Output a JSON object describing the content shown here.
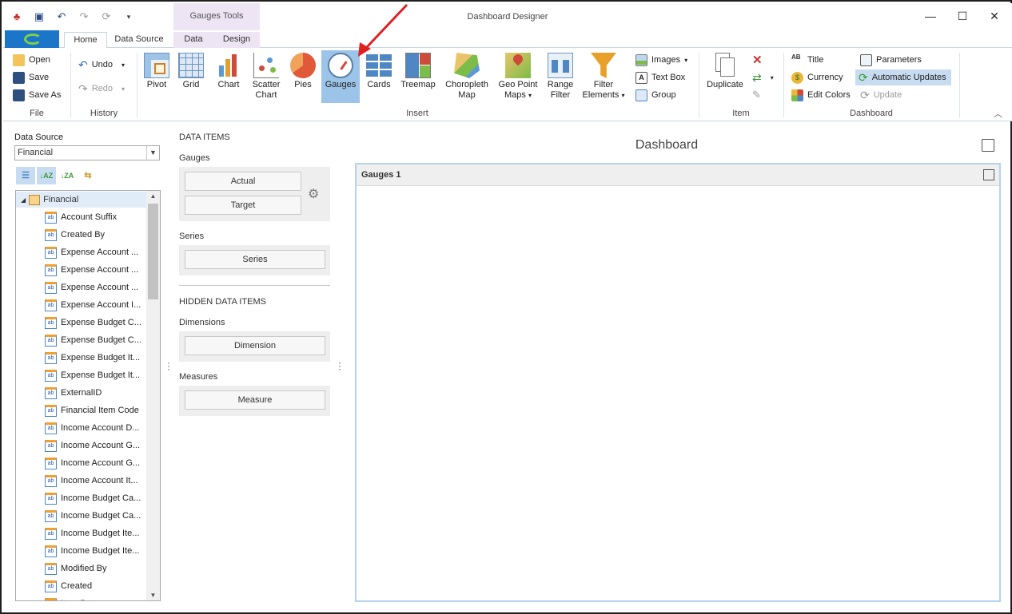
{
  "app_title": "Dashboard Designer",
  "context_tab_group": "Gauges Tools",
  "tabs": [
    "Home",
    "Data Source",
    "Data",
    "Design"
  ],
  "ribbon": {
    "file": {
      "label": "File",
      "open": "Open",
      "save": "Save",
      "save_as": "Save As"
    },
    "history": {
      "label": "History",
      "undo": "Undo",
      "redo": "Redo"
    },
    "insert": {
      "label": "Insert",
      "pivot": "Pivot",
      "grid": "Grid",
      "chart": "Chart",
      "scatter_1": "Scatter",
      "scatter_2": "Chart",
      "pies": "Pies",
      "gauges": "Gauges",
      "cards": "Cards",
      "treemap": "Treemap",
      "choropleth_1": "Choropleth",
      "choropleth_2": "Map",
      "geopoint_1": "Geo Point",
      "geopoint_2": "Maps",
      "range_1": "Range",
      "range_2": "Filter",
      "filter_1": "Filter",
      "filter_2": "Elements",
      "images": "Images",
      "text_box": "Text Box",
      "group": "Group"
    },
    "item": {
      "label": "Item",
      "duplicate": "Duplicate"
    },
    "dashboard": {
      "label": "Dashboard",
      "title": "Title",
      "currency": "Currency",
      "edit_colors": "Edit Colors",
      "parameters": "Parameters",
      "automatic_updates": "Automatic Updates",
      "update": "Update"
    }
  },
  "data_source": {
    "label": "Data Source",
    "selected": "Financial",
    "root": "Financial",
    "fields": [
      "Account Suffix",
      "Created By",
      "Expense Account ...",
      "Expense Account ...",
      "Expense Account ...",
      "Expense Account I...",
      "Expense Budget C...",
      "Expense Budget C...",
      "Expense Budget It...",
      "Expense Budget It...",
      "ExternalID",
      "Financial Item Code",
      "Income Account D...",
      "Income Account G...",
      "Income Account G...",
      "Income Account It...",
      "Income Budget Ca...",
      "Income Budget Ca...",
      "Income Budget Ite...",
      "Income Budget Ite...",
      "Modified By",
      "Created",
      "Item Date"
    ]
  },
  "data_items": {
    "header": "DATA ITEMS",
    "gauges_label": "Gauges",
    "actual": "Actual",
    "target": "Target",
    "series_label": "Series",
    "series": "Series",
    "hidden_header": "HIDDEN DATA ITEMS",
    "dimensions_label": "Dimensions",
    "dimension": "Dimension",
    "measures_label": "Measures",
    "measure": "Measure"
  },
  "dashboard": {
    "title": "Dashboard",
    "item_caption": "Gauges 1"
  },
  "colors": {
    "accent": "#1b75c8",
    "selected": "#9cc3e8",
    "context_tab": "#ede4f4",
    "arrow": "#e02020"
  }
}
